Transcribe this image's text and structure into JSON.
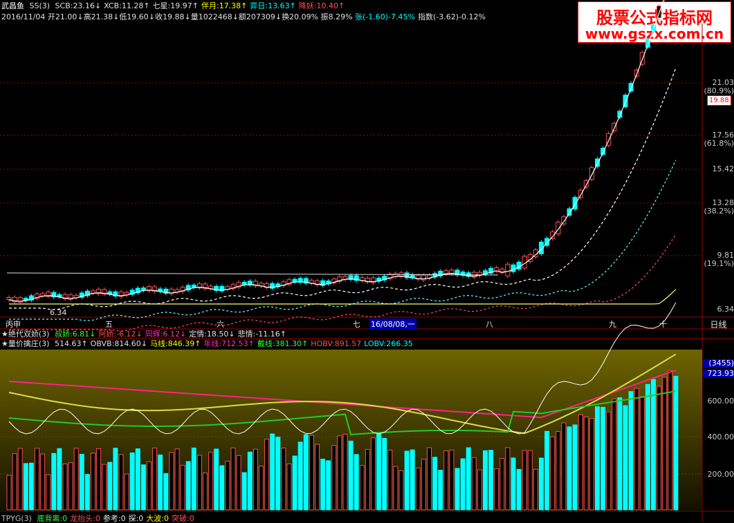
{
  "header": {
    "name": "武昌鱼",
    "code_tag": "SS(3)",
    "indicators_row1": [
      {
        "label": "SCB:23.16",
        "arrow": "↓",
        "cls": "w"
      },
      {
        "label": "XCB:11.28",
        "arrow": "↑",
        "cls": "w"
      },
      {
        "label": "七星:19.97",
        "arrow": "↑",
        "cls": "w"
      },
      {
        "label": "伴月:17.38",
        "arrow": "↑",
        "cls": "y"
      },
      {
        "label": "弈日:13.63",
        "arrow": "↑",
        "cls": "c"
      },
      {
        "label": "降妖:10.40",
        "arrow": "↑",
        "cls": "r"
      }
    ],
    "row2": "2016/11/04 开21.00↓高21.38↓低19.60↓收19.88↓量1022468↓额207309↓换20.09% 振8.29% ",
    "row2_zhang": "张(-1.60)-7.45%",
    "row2_zhishu": "指数(-3.62)-0.12%"
  },
  "logo": {
    "line1": "股票公式指标网",
    "line2": "www.gszx.com.cn"
  },
  "main_axis": {
    "labels": [
      {
        "v": "21.03",
        "pct": "(80.9%)"
      },
      {
        "v": "17.56",
        "pct": "(61.8%)"
      },
      {
        "v": "15.42",
        "pct": ""
      },
      {
        "v": "13.28",
        "pct": "(38.2%)"
      },
      {
        "v": "9.81",
        "pct": "(19.1%)"
      },
      {
        "v": "6.34",
        "pct": ""
      }
    ],
    "current_price": "19.88",
    "low_marker": "6.34"
  },
  "months": [
    "丙申",
    "五",
    "六",
    "七",
    "八",
    "九",
    "十"
  ],
  "selected_date": "16/08/08,一",
  "period": "日线",
  "sub1": {
    "name": "★绝代双娇(3)",
    "items": [
      {
        "label": "叔娇:6.81↓",
        "cls": "g"
      },
      {
        "label": "阿娇:-6.12↓",
        "cls": "r"
      },
      {
        "label": "同辉:6.12↓",
        "cls": "m"
      },
      {
        "label": "定情:18.50↓",
        "cls": "w"
      },
      {
        "label": "悲情:-11.16↑",
        "cls": "w"
      }
    ]
  },
  "sub2": {
    "name": "★量价擒庄(3)",
    "items": [
      {
        "label": "514.63↑",
        "cls": "w"
      },
      {
        "label": "OBVB:814.60↓",
        "cls": "w"
      },
      {
        "label": "马线:846.39↑",
        "cls": "y"
      },
      {
        "label": "年线:712.53↑",
        "cls": "m"
      },
      {
        "label": "戴线:381.30↑",
        "cls": "g"
      },
      {
        "label": "HOBV:891.57",
        "cls": "r"
      },
      {
        "label": "LOBV:266.35",
        "cls": "c"
      }
    ],
    "axis": [
      "(3455)",
      "723.93",
      "600.00",
      "400.00",
      "200.00"
    ]
  },
  "sub3": {
    "name": "TPYG(3)",
    "items": [
      {
        "label": "底背离:0",
        "cls": "g"
      },
      {
        "label": "龙抬头:0",
        "cls": "r"
      },
      {
        "label": "参考:0",
        "cls": "w"
      },
      {
        "label": "探:0",
        "cls": "w"
      },
      {
        "label": "大波:0",
        "cls": "y"
      },
      {
        "label": "突破:0",
        "cls": "r"
      }
    ]
  },
  "colors": {
    "up": "#ff5050",
    "down": "#00ffff",
    "ma_white": "#ffffff",
    "ma_yellow": "#ffff66",
    "vol_bg_top": "#6e6400",
    "vol_bg_bot": "#141000"
  }
}
